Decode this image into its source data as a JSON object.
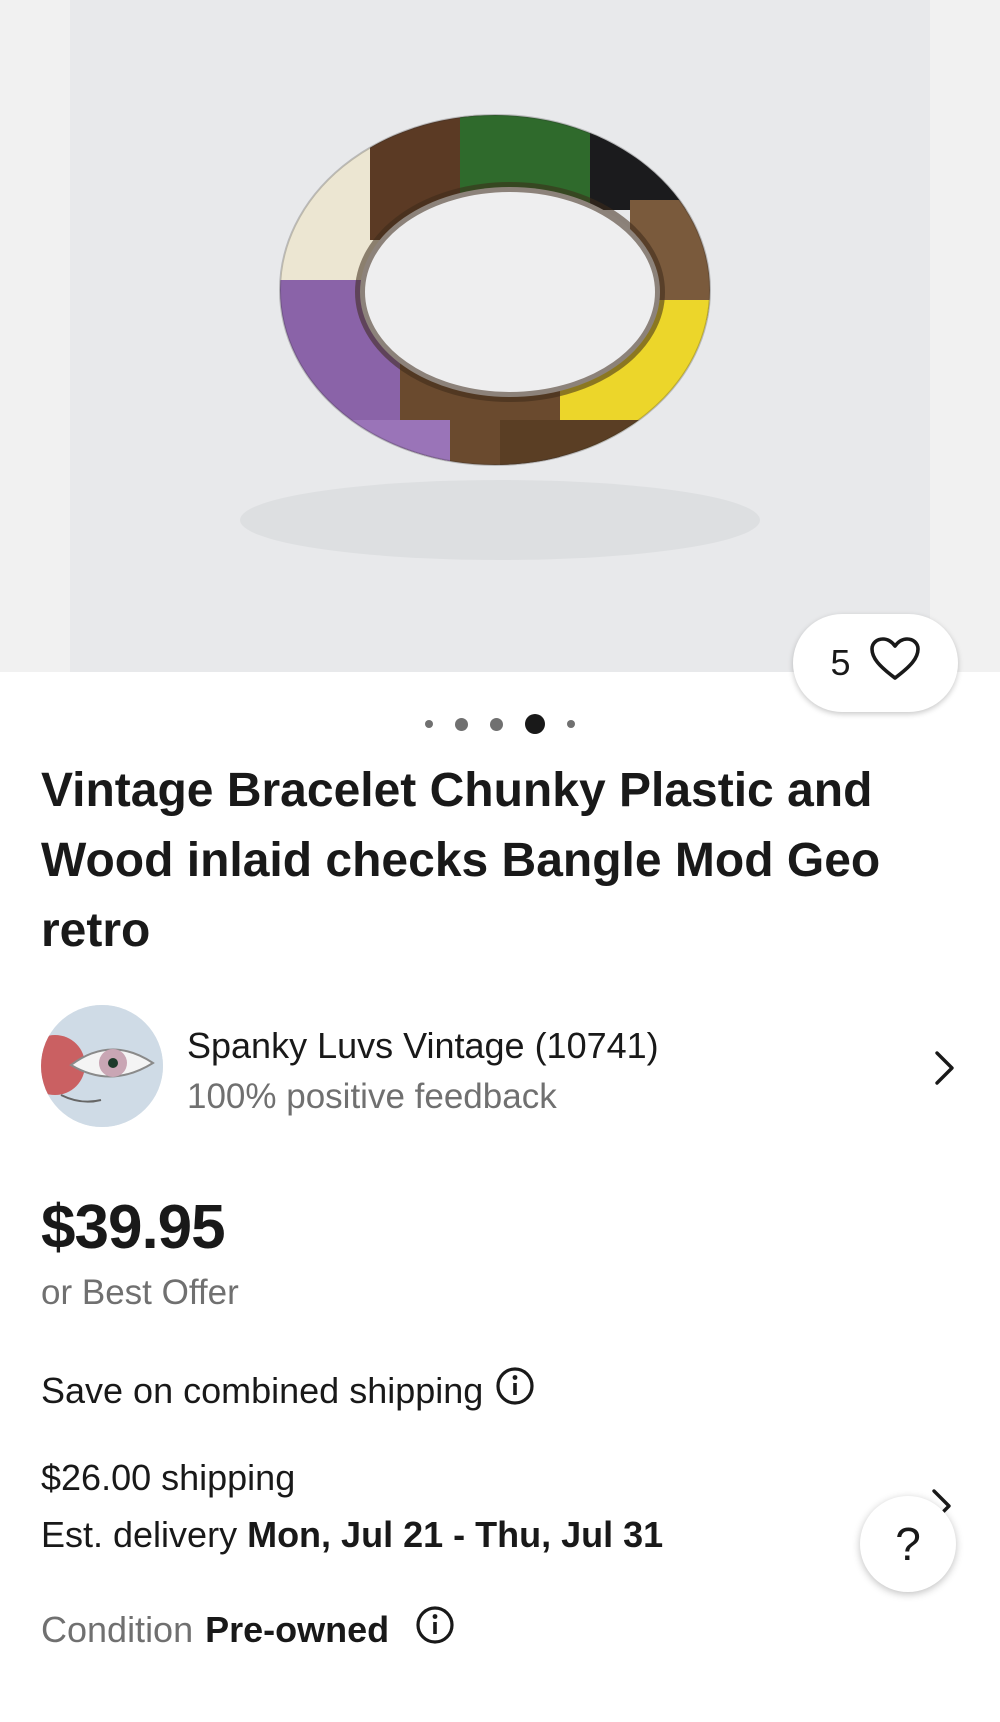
{
  "listing": {
    "image_count": 5,
    "active_image_index": 4,
    "watch_count": "5",
    "title": "Vintage Bracelet Chunky Plastic and Wood inlaid checks Bangle Mod Geo retro"
  },
  "seller": {
    "name": "Spanky Luvs Vintage (10741)",
    "feedback": "100% positive feedback"
  },
  "pricing": {
    "price": "$39.95",
    "offer_note": "or Best Offer"
  },
  "shipping": {
    "combined_label": "Save on combined shipping",
    "cost": "$26.00 shipping",
    "delivery_prefix": "Est. delivery ",
    "delivery_dates": "Mon, Jul 21 - Thu, Jul 31"
  },
  "condition": {
    "label": "Condition",
    "value": "Pre-owned"
  },
  "help": {
    "label": "?"
  },
  "icons": {
    "watch": "heart-outline-icon",
    "info": "info-circle-icon",
    "chevron": "chevron-right-icon"
  },
  "colors": {
    "text_primary": "#191919",
    "text_secondary": "#707070",
    "background": "#ffffff"
  }
}
